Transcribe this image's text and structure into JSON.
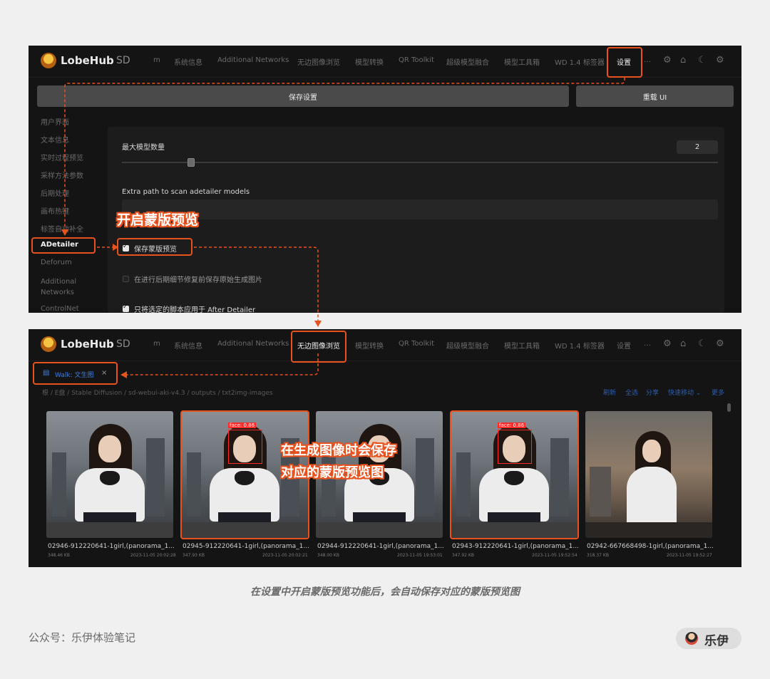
{
  "app": {
    "brand": "LobeHub",
    "brand_suffix": "SD"
  },
  "nav": {
    "tabs": [
      "m",
      "系统信息",
      "Additional Networks",
      "无边图像浏览",
      "模型转换",
      "QR Toolkit",
      "超级模型融合",
      "模型工具箱",
      "WD 1.4 标签器",
      "设置",
      "…"
    ],
    "icons": [
      "gear-icon",
      "github-icon",
      "moon-icon",
      "settings-icon"
    ]
  },
  "settings": {
    "save_label": "保存设置",
    "reload_label": "重载 UI",
    "sidebar": [
      "用户界面",
      "文本信息",
      "实时过程预览",
      "采样方法参数",
      "后期处理",
      "画布热键",
      "标签自动补全",
      "ADetailer",
      "Deforum",
      "Additional Networks",
      "ControlNet"
    ],
    "max_models_label": "最大模型数量",
    "max_models_value": "2",
    "slider_fraction": 0.115,
    "extra_path_label": "Extra path to scan adetailer models",
    "opt_save_mask": "保存蒙版预览",
    "opt_save_original": "在进行后期细节修复前保存原始生成图片",
    "opt_apply_script": "只将选定的脚本应用于 After Detailer"
  },
  "callouts": {
    "enable_mask": "开启蒙版预览",
    "gen_line1": "在生成图像时会保存",
    "gen_line2": "对应的蒙版预览图"
  },
  "browser": {
    "walk_tab": "Walk: 文生图",
    "breadcrumb": "根 / E盘 / Stable Diffusion / sd-webui-aki-v4.3 / outputs / txt2img-images",
    "actions": [
      "刷新",
      "全选",
      "分享",
      "快速移动 ⌄",
      "更多"
    ],
    "face_label": "face: 0.86",
    "images": [
      {
        "name": "02946-912220641-1girl,(panorama_1...",
        "size": "348.46 KB",
        "date": "2023-11-05 20:02:28",
        "mask": false
      },
      {
        "name": "02945-912220641-1girl,(panorama_1...",
        "size": "347.93 KB",
        "date": "2023-11-05 20:02:21",
        "mask": true
      },
      {
        "name": "02944-912220641-1girl,(panorama_1...",
        "size": "348.00 KB",
        "date": "2023-11-05 19:53:01",
        "mask": false
      },
      {
        "name": "02943-912220641-1girl,(panorama_1...",
        "size": "347.92 KB",
        "date": "2023-11-05 19:52:54",
        "mask": true
      },
      {
        "name": "02942-667668498-1girl,(panorama_1...",
        "size": "318.37 KB",
        "date": "2023-11-05 19:52:27",
        "mask": false
      }
    ]
  },
  "caption": "在设置中开启蒙版预览功能后，会自动保存对应的蒙版预览图",
  "footer": {
    "account": "公众号：乐伊体验笔记",
    "author": "乐伊"
  },
  "colors": {
    "accent": "#e8521e",
    "panel": "#141414",
    "page": "#f0f0f0",
    "link": "#3f7fe0"
  }
}
